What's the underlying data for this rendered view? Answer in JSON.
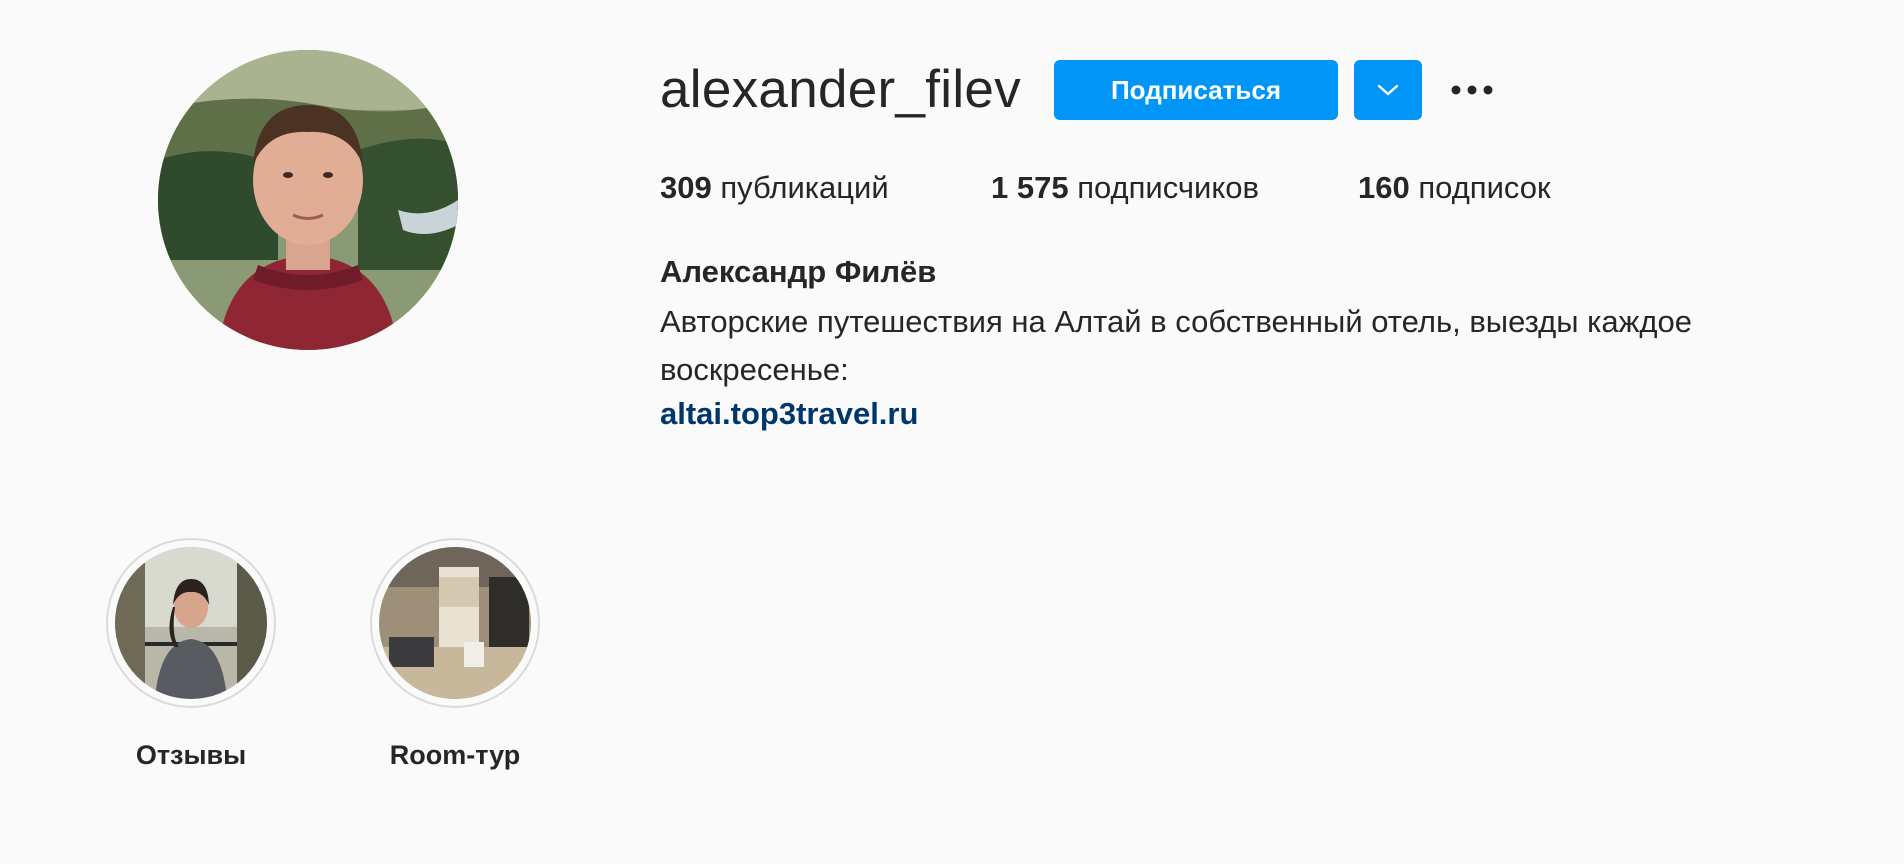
{
  "profile": {
    "username": "alexander_filev",
    "follow_label": "Подписаться",
    "dropdown_icon": "chevron-down-icon",
    "more_icon": "more-options-icon",
    "stats": [
      {
        "count": "309",
        "label": "публикаций"
      },
      {
        "count": "1 575",
        "label": "подписчиков"
      },
      {
        "count": "160",
        "label": "подписок"
      }
    ],
    "full_name": "Александр Филёв",
    "bio": "Авторские путешествия на Алтай в собственный отель, выезды каждое воскресенье:",
    "link": "altai.top3travel.ru"
  },
  "highlights": [
    {
      "label": "Отзывы"
    },
    {
      "label": "Room-тур"
    }
  ],
  "colors": {
    "accent": "#0095f6",
    "link": "#00376b",
    "text": "#262626",
    "background": "#fafafa"
  }
}
